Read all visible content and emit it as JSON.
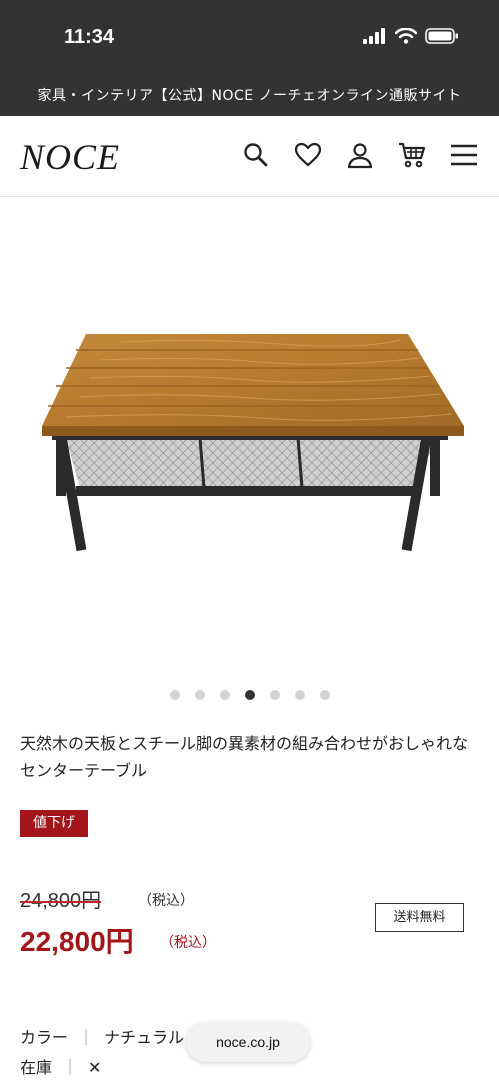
{
  "status_bar": {
    "time": "11:34"
  },
  "page_title": "家具・インテリア【公式】NOCE ノーチェオンライン通販サイト",
  "header": {
    "logo": "NOCE",
    "icons": [
      "search-icon",
      "heart-icon",
      "user-icon",
      "cart-icon",
      "menu-icon"
    ]
  },
  "carousel": {
    "count": 7,
    "active_index": 3
  },
  "product": {
    "description": "天然木の天板とスチール脚の異素材の組み合わせがおしゃれなセンターテーブル",
    "badge": "値下げ",
    "old_price": "24,800円",
    "old_tax": "（税込）",
    "new_price": "22,800円",
    "new_tax": "（税込）",
    "shipping": "送料無料",
    "color_label": "カラー",
    "color_value": "ナチュラル",
    "stock_label": "在庫",
    "stock_value": "✕"
  },
  "browser": {
    "url": "noce.co.jp"
  },
  "colors": {
    "header_bg": "#333333",
    "accent_red": "#a4141b",
    "strike_red": "#c0262c"
  }
}
